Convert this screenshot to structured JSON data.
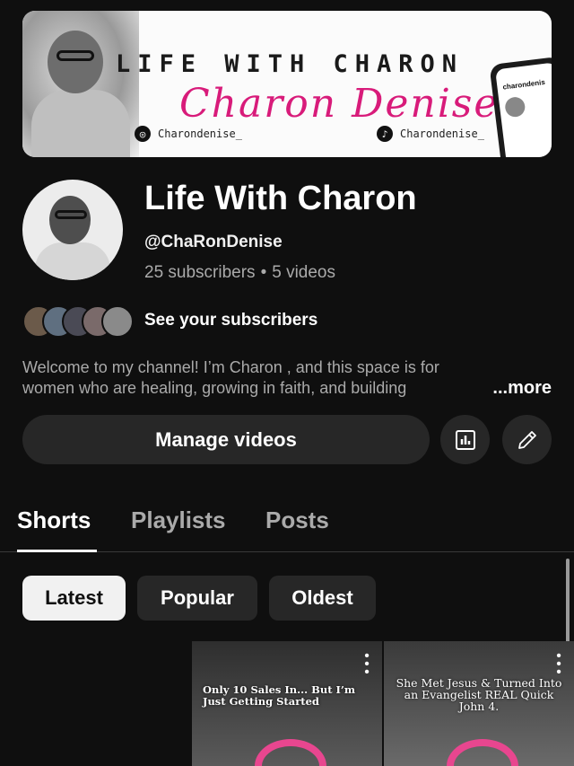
{
  "banner": {
    "title": "LIFE WITH CHARON",
    "script_text": "Charon Denise",
    "instagram_handle": "Charondenise_",
    "tiktok_handle": "Charondenise_",
    "phone_username": "charondenis"
  },
  "channel": {
    "name": "Life With Charon",
    "handle": "@ChaRonDenise",
    "subscribers": "25 subscribers",
    "separator": "•",
    "videos": "5 videos",
    "see_subscribers": "See your subscribers",
    "description_line1": "Welcome to my channel! I’m Charon , and this space is for",
    "description_line2": "women who are healing, growing in faith, and building",
    "more_label": "...more"
  },
  "actions": {
    "manage_videos": "Manage videos",
    "analytics_icon": "analytics-icon",
    "edit_icon": "pencil-icon"
  },
  "tabs": [
    {
      "label": "Shorts",
      "active": true
    },
    {
      "label": "Playlists",
      "active": false
    },
    {
      "label": "Posts",
      "active": false
    }
  ],
  "filters": [
    {
      "label": "Latest",
      "active": true
    },
    {
      "label": "Popular",
      "active": false
    },
    {
      "label": "Oldest",
      "active": false
    }
  ],
  "shorts": [
    {
      "caption": ""
    },
    {
      "caption": "Only 10 Sales In... But I’m Just Getting Started"
    },
    {
      "caption": "She Met Jesus & Turned Into an Evangelist REAL Quick John 4."
    }
  ],
  "colors": {
    "background": "#0f0f0f",
    "button_bg": "#272727",
    "text_primary": "#ffffff",
    "text_secondary": "#aaaaaa",
    "banner_pink": "#d81b7a"
  }
}
